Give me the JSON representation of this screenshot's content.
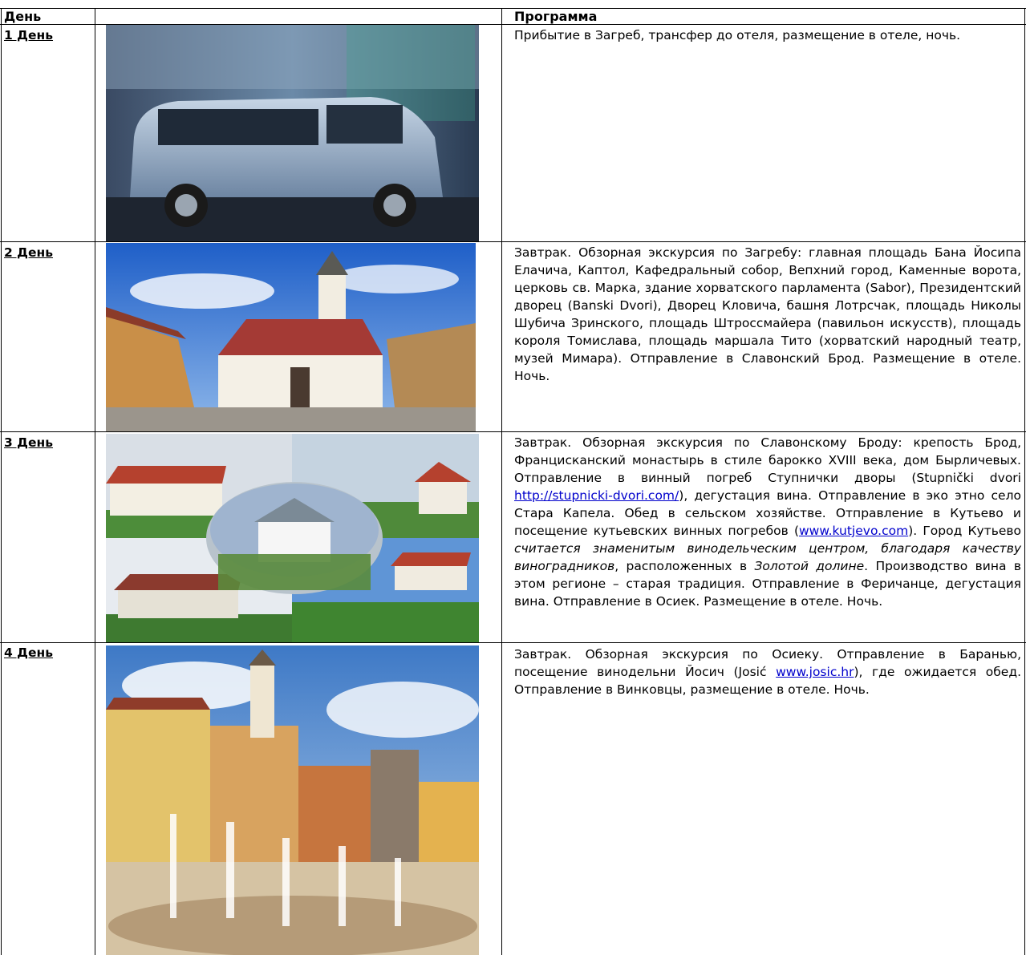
{
  "header": {
    "day_col": "День",
    "image_col": "",
    "program_col": "Программа"
  },
  "rows": [
    {
      "day": "1 День",
      "image": "minivan-photo",
      "program": "Прибытие в Загреб, трансфер до отеля, размещение в отеле, ночь."
    },
    {
      "day": "2 День",
      "image": "church-photo",
      "program": "Завтрак. Обзорная экскурсия по Загребу: главная площадь Бана Йосипа Елачича, Каптол, Кафедральный собор, Вепхний город, Каменные ворота, церковь св. Марка, здание хорватского парламента (Sabor), Президентский дворец (Banski Dvori), Дворец Кловича, башня Лотрсчак, площадь Николы Шубича Зринского, площадь Штроссмайера (павильон искусств), площадь короля Томислава, площадь маршала Тито (хорватский народный театр, музей Мимара). Отправление в Славонский Брод. Размещение в отеле. Ночь."
    },
    {
      "day": "3 День",
      "image": "fortress-collage",
      "program_part1": "Завтрак. Обзорная экскурсия по Славонскому Броду: крепость Брод, Францисканский монастырь в стиле барокко XVIII века, дом Бырличевых. Отправление в винный погреб Ступнички дворы (Stupnički dvori ",
      "link1": "http://stupnicki-dvori.com/",
      "program_part2": "), дегустация вина. Отправление в эко этно село Стара Капела. Обед в сельском хозяйстве. Отправление в Кутьево и посещение кутьевских винных погребов (",
      "link2": "www.kutjevo.com",
      "program_part3": "). Город Кутьево ",
      "italic1": "считается знаменитым винодельческим центром, благодаря качеству виноградников",
      "program_part4": ", расположенных в ",
      "italic2": "Золотой долине",
      "program_part5": ". Производство вина в этом регионе – старая традиция. Отправление в Феричанце, дегустация вина. Отправление в Осиек. Размещение в отеле. Ночь."
    },
    {
      "day": "4 День",
      "image": "fountain-square-photo",
      "program_part1": "Завтрак. Обзорная экскурсия по Осиеку. Отправление в Баранью, посещение винодельни Йосич (Josić  ",
      "link1": "www.josic.hr",
      "program_part2": "), где ожидается обед. Отправление в Винковцы, размещение в отеле. Ночь."
    }
  ],
  "colors": {
    "sky": "#2c6fd6",
    "roof_red": "#b5412e",
    "grass": "#4f8a3a"
  }
}
